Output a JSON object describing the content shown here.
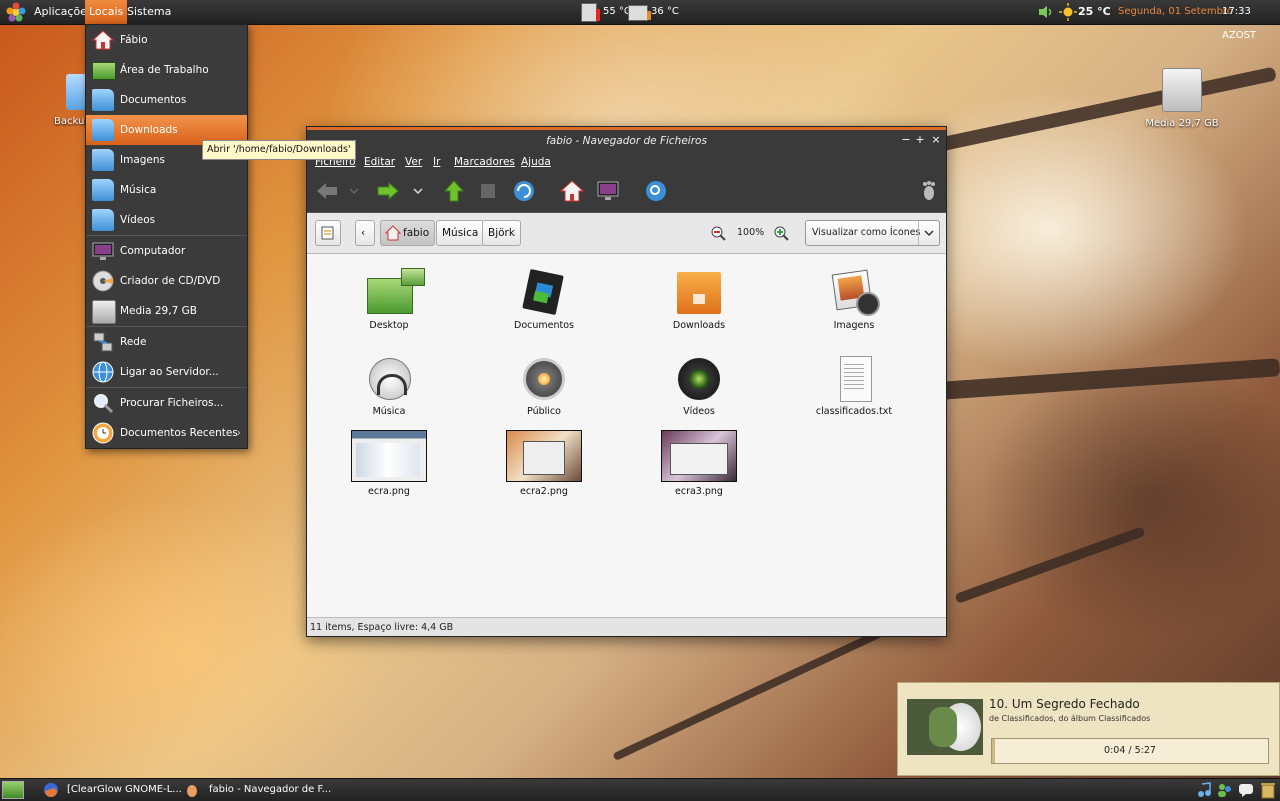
{
  "top_panel": {
    "applications": "Aplicações",
    "places": "Locais",
    "system": "Sistema",
    "cpu_temp": "55 °C",
    "hdd_temp": "36 °C",
    "weather_temp": "25 °C",
    "date": "Segunda, 01 Setembro",
    "time": "17:33 AZOST"
  },
  "desktop": {
    "icons": [
      {
        "label": "Backup"
      },
      {
        "label": "Media 29,7 GB"
      }
    ]
  },
  "places_menu": {
    "items": [
      {
        "label": "Fábio"
      },
      {
        "label": "Área de Trabalho"
      },
      {
        "label": "Documentos"
      },
      {
        "label": "Downloads"
      },
      {
        "label": "Imagens"
      },
      {
        "label": "Música"
      },
      {
        "label": "Vídeos"
      },
      {
        "label": "Computador"
      },
      {
        "label": "Criador de CD/DVD"
      },
      {
        "label": "Media 29,7 GB"
      },
      {
        "label": "Rede"
      },
      {
        "label": "Ligar ao Servidor..."
      },
      {
        "label": "Procurar Ficheiros..."
      },
      {
        "label": "Documentos Recentes"
      }
    ],
    "tooltip": "Abrir '/home/fabio/Downloads'"
  },
  "file_manager": {
    "title": "fabio - Navegador de Ficheiros",
    "menu": [
      "Ficheiro",
      "Editar",
      "Ver",
      "Ir",
      "Marcadores",
      "Ajuda"
    ],
    "breadcrumbs": [
      "fabio",
      "Música",
      "Björk"
    ],
    "zoom": "100%",
    "view_mode": "Visualizar como Ícones",
    "files": [
      {
        "name": "Desktop"
      },
      {
        "name": "Documentos"
      },
      {
        "name": "Downloads"
      },
      {
        "name": "Imagens"
      },
      {
        "name": "Música"
      },
      {
        "name": "Público"
      },
      {
        "name": "Vídeos"
      },
      {
        "name": "classificados.txt"
      },
      {
        "name": "ecra.png"
      },
      {
        "name": "ecra2.png"
      },
      {
        "name": "ecra3.png"
      }
    ],
    "status": "11 items, Espaço livre: 4,4 GB"
  },
  "notification": {
    "song": "10. Um Segredo Fechado",
    "subtitle": "de Classificados, do álbum Classificados",
    "time": "0:04 / 5:27",
    "progress_fraction": 0.012
  },
  "taskbar": {
    "tasks": [
      {
        "label": "[ClearGlow GNOME-L..."
      },
      {
        "label": "fabio - Navegador de F..."
      }
    ]
  },
  "colors": {
    "accent": "#e06b26",
    "panel": "#2c2c2c",
    "selection": "#e8782f"
  }
}
